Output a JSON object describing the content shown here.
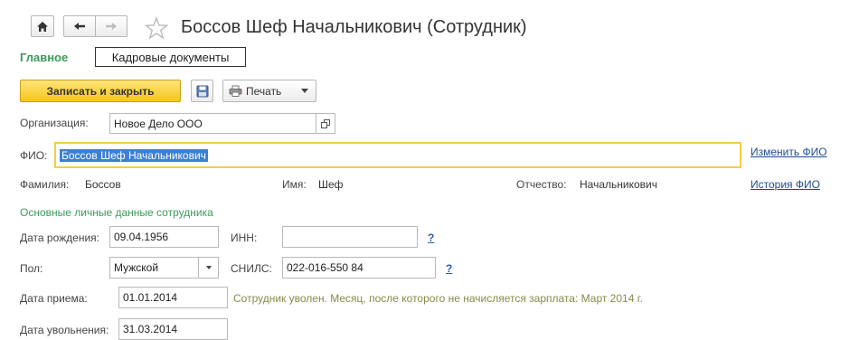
{
  "header": {
    "title": "Боссов Шеф Начальникович (Сотрудник)",
    "home_icon": "home-icon",
    "back_icon": "arrow-left-icon",
    "forward_icon": "arrow-right-icon",
    "favorite_icon": "star-icon"
  },
  "nav": {
    "main": "Главное",
    "tab": "Кадровые документы"
  },
  "toolbar": {
    "save_close_label": "Записать и закрыть",
    "print_label": "Печать"
  },
  "form": {
    "organization": {
      "label": "Организация:",
      "value": "Новое Дело ООО"
    },
    "fio": {
      "label": "ФИО:",
      "value": "Боссов Шеф Начальникович",
      "change_link": "Изменить ФИО",
      "history_link": "История ФИО"
    },
    "surname": {
      "label": "Фамилия:",
      "value": "Боссов"
    },
    "name": {
      "label": "Имя:",
      "value": "Шеф"
    },
    "patronymic": {
      "label": "Отчество:",
      "value": "Начальникович"
    },
    "section_title": "Основные личные данные сотрудника",
    "birth_date": {
      "label": "Дата рождения:",
      "value": "09.04.1956"
    },
    "inn": {
      "label": "ИНН:",
      "value": "",
      "help": "?"
    },
    "gender": {
      "label": "Пол:",
      "value": "Мужской"
    },
    "snils": {
      "label": "СНИЛС:",
      "value": "022-016-550 84",
      "help": "?"
    },
    "hire_date": {
      "label": "Дата приема:",
      "value": "01.01.2014"
    },
    "status_note": "Сотрудник уволен. Месяц, после которого не начисляется зарплата: Март 2014 г.",
    "dismissal_date": {
      "label": "Дата увольнения:",
      "value": "31.03.2014"
    }
  }
}
